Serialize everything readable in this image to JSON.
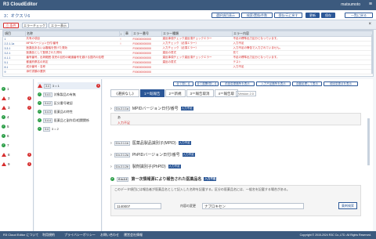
{
  "app": {
    "title": "R3 CloudEditor",
    "user": "matsumoto"
  },
  "docbar": {
    "back_label": "3：オクスリ6",
    "buttons": [
      "選択項目表示",
      "検索/置換/件数",
      "保存/元に戻す",
      "更新",
      "保存",
      "一覧に戻る"
    ]
  },
  "errbar": {
    "error_label": "⚠ 条件",
    "btn1": "エラーチェック",
    "btn2": "エラー表示"
  },
  "errtable": {
    "headers": [
      "項目",
      "名称",
      "!",
      "章",
      "エラー番号",
      "エラー種類",
      "エラー内容"
    ],
    "rows": [
      [
        "1",
        "共有の項目",
        "!",
        "",
        "F00000000000",
        "違反事項チェック違反項チェックエラー",
        "不足の標準出力区分となっています。"
      ],
      [
        "2.2.1.1a",
        "MPIDバージョン日付/番号",
        "!",
        "",
        "F00000000000",
        "入力チェック（必須エラー）",
        "入力不足"
      ],
      [
        "3.3.1",
        "医薬品あるいは審議を受けた発効",
        "",
        "",
        "F00000000000",
        "入力チェック（必須エラー）",
        "入力不足の警告で入力されていません。"
      ],
      [
        "3.2.1",
        "医薬品として登録された資料",
        "",
        "",
        "F00000000000",
        "違反の書式",
        "充て"
      ],
      [
        "4.1.1",
        "番号番号，出荷範囲 収売の目的の報道番号を避ける国内の処理",
        "",
        "",
        "F00000000000",
        "違反事項チェック違反項チェックエラー",
        "不足の標準出力区分となっています。"
      ],
      [
        "5.1",
        "都道府県名の判定",
        "",
        "",
        "F00000000000",
        "違反の書式",
        "テスト"
      ],
      [
        "8.1",
        "成分番号・名称",
        "",
        "",
        "F00000000000",
        "",
        "入力不足"
      ],
      [
        "9",
        "添付書類の選択",
        "",
        "",
        "F00000000000",
        "",
        ""
      ]
    ]
  },
  "left_items": [
    {
      "label": "1",
      "status": "ok"
    },
    {
      "label": "2",
      "status": "warn",
      "badge": "1"
    },
    {
      "label": "3",
      "status": "warn",
      "badge": "2"
    },
    {
      "label": "4",
      "status": "ok"
    },
    {
      "label": "5",
      "status": "ok"
    },
    {
      "label": "6",
      "status": "ok"
    },
    {
      "label": "7",
      "status": "ok"
    },
    {
      "label": "8",
      "status": "warn",
      "badge": "1"
    },
    {
      "label": "9",
      "status": "warn",
      "badge": "1"
    }
  ],
  "mid_items": [
    {
      "code": "3.4",
      "label": "3 = 1",
      "status": "warn",
      "badge": "1",
      "sel": true
    },
    {
      "code": "3.4.1",
      "label": "対象製品の有無",
      "status": "ok"
    },
    {
      "code": "3.4.2",
      "label": "区分番号確認",
      "status": "ok"
    },
    {
      "code": "3.4.3",
      "label": "医薬品の特性",
      "status": "ok"
    },
    {
      "code": "3.4.4",
      "label": "医薬品と副作用/相関関係",
      "status": "ok"
    },
    {
      "code": "3.4",
      "label": "3 = 2",
      "status": "ok"
    }
  ],
  "content": {
    "top_buttons": [
      "全て閉じる",
      "全て展開/閉じる",
      "前回変更箇所を表示",
      "入力不足箇所を表示",
      "自動処理して表示",
      "前回変更点を表示"
    ],
    "tabs": [
      "《選択なし》",
      "1＝既報告",
      "2＝新規",
      "3＝報告取消",
      "4＝報告取"
    ],
    "version": "Version 2.0",
    "sections": [
      {
        "code": "G.k.2.1.1a",
        "title": "MPIDバージョン日付/番号",
        "chip": "入力不足"
      },
      {
        "code": "G.k.2.1.1b",
        "title": "医薬品製品識別子(MPID)",
        "chip": "入力不足"
      },
      {
        "code": "G.k.2.1.2a",
        "title": "PhPIDバージョン日付/番号",
        "chip": "入力不足"
      },
      {
        "code": "G.k.2.1.2b",
        "title": "製剤識別子(PhPID)",
        "chip": "入力不足"
      },
      {
        "code": "G.k.2.2",
        "title": "第一次情報源により報告された医薬品名",
        "chip": "入力不足"
      }
    ],
    "gray_text": "入力不足",
    "note": "このデータ項目には報告者が医薬品名として記入した名称を記載する。区分の医薬品名には、一般名を記載する場合がある。",
    "code_value": "1140007",
    "field_label": "内容の変更",
    "field_value": "ナプロキセン",
    "search_btn": "薬剤検索"
  },
  "footer": {
    "items": [
      "R3 Cloud Editor について",
      "利用規約",
      "プライバシーポリシー",
      "お問い合わせ",
      "運営会社情報"
    ],
    "copyright": "Copyright © 2015-2024 R3C Co.,LTD. All Rights Reserved."
  },
  "colors": {
    "brand": "#3c5a7e",
    "accent": "#2b5797",
    "error": "#d62d2d",
    "ok": "#2a9d46"
  }
}
